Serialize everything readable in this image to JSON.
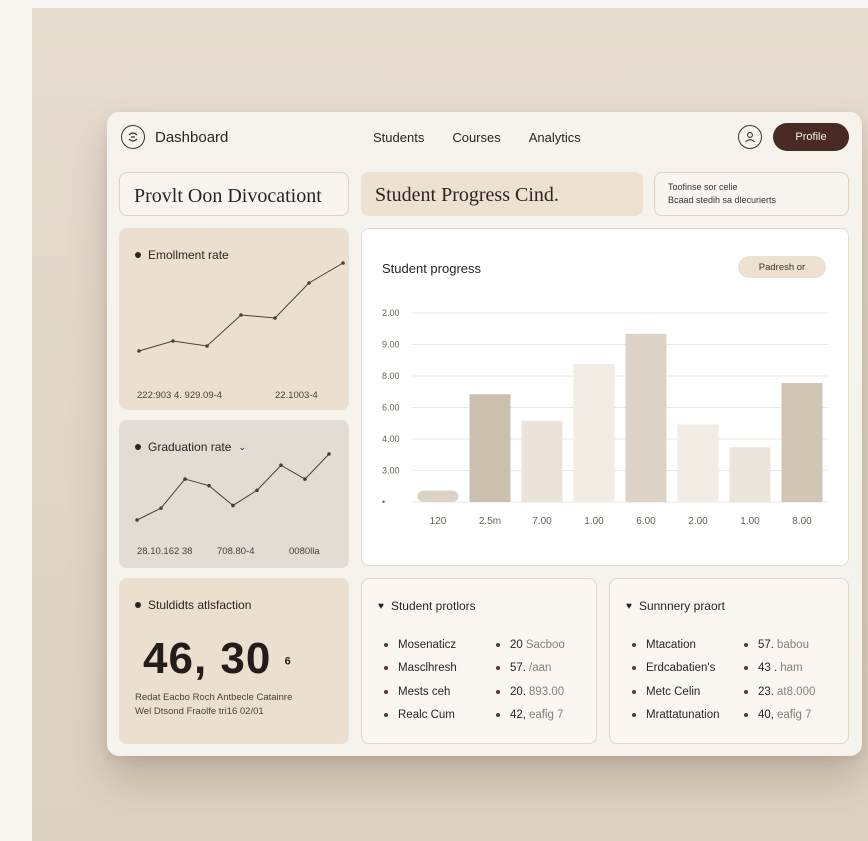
{
  "header": {
    "app_title": "Dashboard",
    "nav": [
      "Students",
      "Courses",
      "Analytics"
    ],
    "profile_label": "Profile"
  },
  "banners": {
    "left_title": "Provlt Oon Divocationt",
    "center_title": "Student Progress Cind.",
    "right_line1": "Toofinse sor celie",
    "right_line2": "Bcaad stedih sa dlecurierts"
  },
  "enrollment": {
    "title": "Emollment rate",
    "footer_left": "222:903 4. 929.09-4",
    "footer_right": "22.1003-4",
    "trend": [
      {
        "x": 0,
        "y": 0.12
      },
      {
        "x": 1,
        "y": 0.22
      },
      {
        "x": 2,
        "y": 0.17
      },
      {
        "x": 3,
        "y": 0.48
      },
      {
        "x": 4,
        "y": 0.45
      },
      {
        "x": 5,
        "y": 0.8
      },
      {
        "x": 6,
        "y": 1.0
      }
    ]
  },
  "graduation": {
    "title": "Graduation rate",
    "footer_left": "28.10.162 38",
    "footer_mid": "708.80-4",
    "footer_right": "0080lla",
    "trend": [
      {
        "x": 0,
        "y": 0.0
      },
      {
        "x": 1,
        "y": 0.18
      },
      {
        "x": 2,
        "y": 0.62
      },
      {
        "x": 3,
        "y": 0.52
      },
      {
        "x": 4,
        "y": 0.22
      },
      {
        "x": 5,
        "y": 0.45
      },
      {
        "x": 6,
        "y": 0.83
      },
      {
        "x": 7,
        "y": 0.62
      },
      {
        "x": 8,
        "y": 1.0
      }
    ]
  },
  "satisfaction": {
    "title": "Stuldidts atlsfaction",
    "value": "46, 30",
    "value_suffix": "6",
    "desc_line1": "Redat Eacbo Roch Antbecle Catainre",
    "desc_line2": "Wel Dtsond Fraolfe tri16 02/01"
  },
  "chart_data": {
    "type": "bar",
    "title": "Student progress",
    "button_label": "Padresh or",
    "y_ticks": [
      "2.00",
      "9.00",
      "8.00",
      "6.00",
      "4.00",
      "3.00",
      "•"
    ],
    "categories": [
      "120",
      "2.5m",
      "7.00",
      "1.00",
      "6.00",
      "2.00",
      "1.00",
      "8.00"
    ],
    "values": [
      0.06,
      0.57,
      0.43,
      0.73,
      0.89,
      0.41,
      0.29,
      0.63
    ],
    "colors": [
      "#dcd2c5",
      "#cbbfad",
      "#ece4da",
      "#f2ece5",
      "#ddd3c6",
      "#f2ece5",
      "#ece5dc",
      "#d2c5b4"
    ],
    "grid": true
  },
  "protections": {
    "title": "Student protlors",
    "rows": [
      {
        "name": "Mosenaticz",
        "num": "20",
        "rest": "Sacboo"
      },
      {
        "name": "Masclhresh",
        "num": "57.",
        "rest": "/aan"
      },
      {
        "name": "Mests ceh",
        "num": "20.",
        "rest": "893.00"
      },
      {
        "name": "Realc Cum",
        "num": "42,",
        "rest": "eafig 7"
      }
    ]
  },
  "summary": {
    "title": "Sunnnery praort",
    "rows": [
      {
        "name": "Mtacation",
        "num": "57.",
        "rest": "babou"
      },
      {
        "name": "Erdcabatien's",
        "num": "43 .",
        "rest": "ham"
      },
      {
        "name": "Metc Celin",
        "num": "23.",
        "rest": "at8.000"
      },
      {
        "name": "Mrattatunation",
        "num": "40,",
        "rest": "eafig 7"
      }
    ]
  },
  "colors": {
    "accent": "#4a2b24",
    "card_tan": "#ebe0d0",
    "card_grey": "#e2dcd4",
    "line": "#4a3f38"
  }
}
